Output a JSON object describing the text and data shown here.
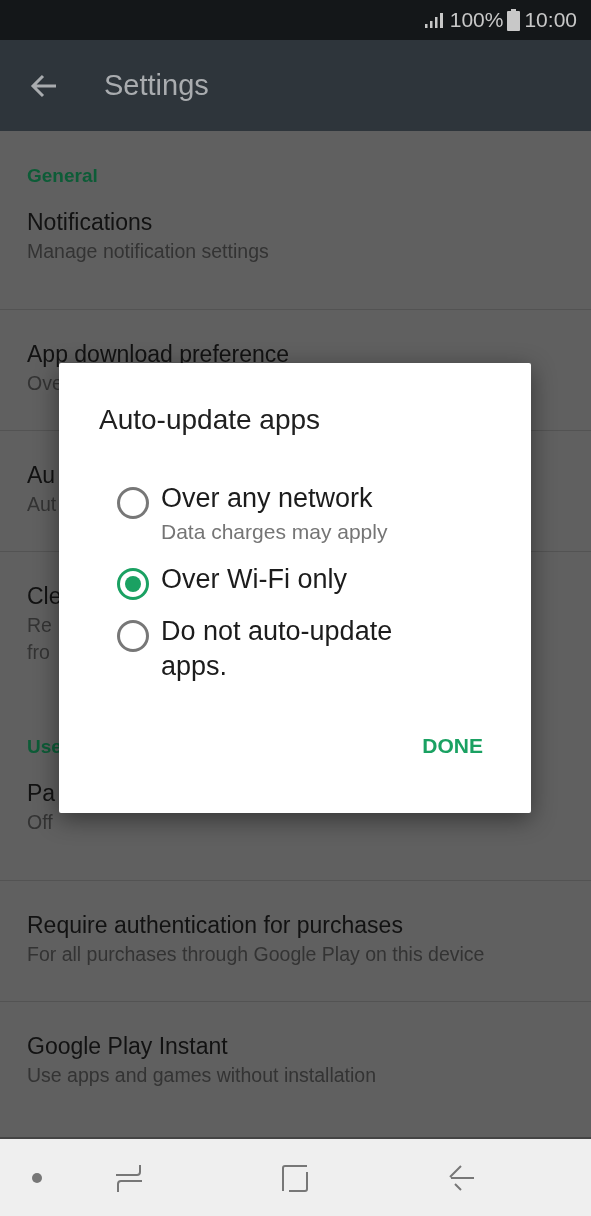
{
  "status_bar": {
    "battery": "100%",
    "time": "10:00"
  },
  "app_bar": {
    "title": "Settings"
  },
  "sections": [
    {
      "header": "General",
      "items": [
        {
          "title": "Notifications",
          "subtitle_lines": [
            "Manage notification settings"
          ]
        },
        {
          "title": "App download preference",
          "subtitle_lines": [
            "Ove"
          ]
        },
        {
          "title": "Au",
          "subtitle_lines": [
            "Aut"
          ]
        },
        {
          "title": "Cle",
          "subtitle_lines": [
            "Re",
            "fro"
          ]
        }
      ]
    },
    {
      "header": "Use",
      "items": [
        {
          "title": "Pa",
          "subtitle_lines": [
            "Off"
          ]
        },
        {
          "title": "Require authentication for purchases",
          "subtitle_lines": [
            "For all purchases through Google Play on this device"
          ]
        },
        {
          "title": "Google Play Instant",
          "subtitle_lines": [
            "Use apps and games without installation"
          ]
        }
      ]
    }
  ],
  "dialog": {
    "title": "Auto-update apps",
    "options": [
      {
        "label": "Over any network",
        "summary": "Data charges may apply",
        "selected": false
      },
      {
        "label": "Over Wi-Fi only",
        "selected": true
      },
      {
        "label": "Do not auto-update apps.",
        "selected": false
      }
    ],
    "button": "DONE"
  }
}
